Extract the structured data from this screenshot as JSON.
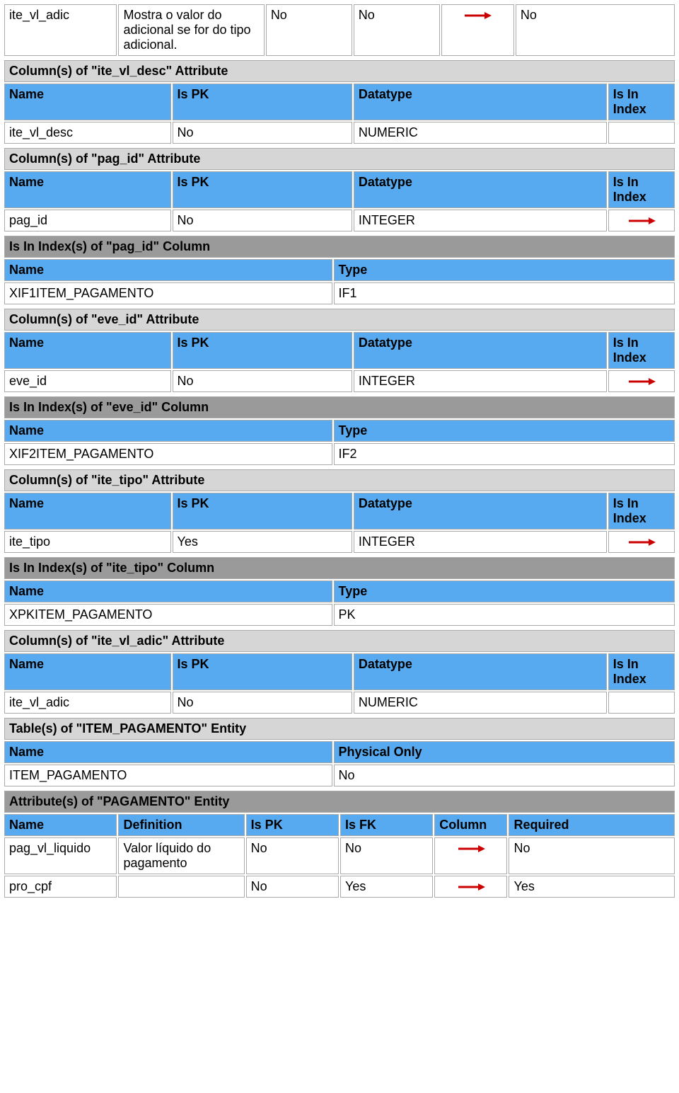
{
  "firstRow": {
    "c0": "ite_vl_adic",
    "c1": "Mostra o valor do adicional se for do tipo adicional.",
    "c2": "No",
    "c3": "No",
    "c5": "No"
  },
  "labels": {
    "name": "Name",
    "ispk": "Is PK",
    "datatype": "Datatype",
    "inindex": "Is In Index",
    "type": "Type",
    "physonly": "Physical Only",
    "definition": "Definition",
    "isfk": "Is FK",
    "column": "Column",
    "required": "Required"
  },
  "sec_ite_vl_desc": {
    "title": "Column(s) of \"ite_vl_desc\" Attribute",
    "row": {
      "name": "ite_vl_desc",
      "pk": "No",
      "dt": "NUMERIC",
      "idx": ""
    }
  },
  "sec_pag_id": {
    "title": "Column(s) of \"pag_id\" Attribute",
    "row": {
      "name": "pag_id",
      "pk": "No",
      "dt": "INTEGER"
    }
  },
  "idx_pag_id": {
    "title": "Is In Index(s) of \"pag_id\" Column",
    "row": {
      "name": "XIF1ITEM_PAGAMENTO",
      "type": "IF1"
    }
  },
  "sec_eve_id": {
    "title": "Column(s) of \"eve_id\" Attribute",
    "row": {
      "name": "eve_id",
      "pk": "No",
      "dt": "INTEGER"
    }
  },
  "idx_eve_id": {
    "title": "Is In Index(s) of \"eve_id\" Column",
    "row": {
      "name": "XIF2ITEM_PAGAMENTO",
      "type": "IF2"
    }
  },
  "sec_ite_tipo": {
    "title": "Column(s) of \"ite_tipo\" Attribute",
    "row": {
      "name": "ite_tipo",
      "pk": "Yes",
      "dt": "INTEGER"
    }
  },
  "idx_ite_tipo": {
    "title": "Is In Index(s) of \"ite_tipo\" Column",
    "row": {
      "name": "XPKITEM_PAGAMENTO",
      "type": "PK"
    }
  },
  "sec_ite_vl_adic": {
    "title": "Column(s) of \"ite_vl_adic\" Attribute",
    "row": {
      "name": "ite_vl_adic",
      "pk": "No",
      "dt": "NUMERIC",
      "idx": ""
    }
  },
  "tbl_item_pag": {
    "title": "Table(s) of \"ITEM_PAGAMENTO\" Entity",
    "row": {
      "name": "ITEM_PAGAMENTO",
      "phys": "No"
    }
  },
  "attr_pag": {
    "title": "Attribute(s) of \"PAGAMENTO\" Entity",
    "rows": [
      {
        "name": "pag_vl_liquido",
        "def": "Valor líquido do pagamento",
        "pk": "No",
        "fk": "No",
        "req": "No"
      },
      {
        "name": "pro_cpf",
        "def": "",
        "pk": "No",
        "fk": "Yes",
        "req": "Yes"
      }
    ]
  }
}
